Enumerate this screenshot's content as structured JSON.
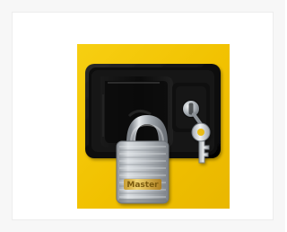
{
  "image": {
    "alt": "",
    "subject": "cabinet-lock-with-padlock",
    "panel_color": "#f5c400",
    "latch_color": "#111111",
    "padlock_body_color": "#c9ccd0",
    "shackle_color": "#b8bcc0",
    "key_color": "#d9dcdf",
    "brand_label": "Master",
    "brand_text_color": "#7a5a10"
  }
}
